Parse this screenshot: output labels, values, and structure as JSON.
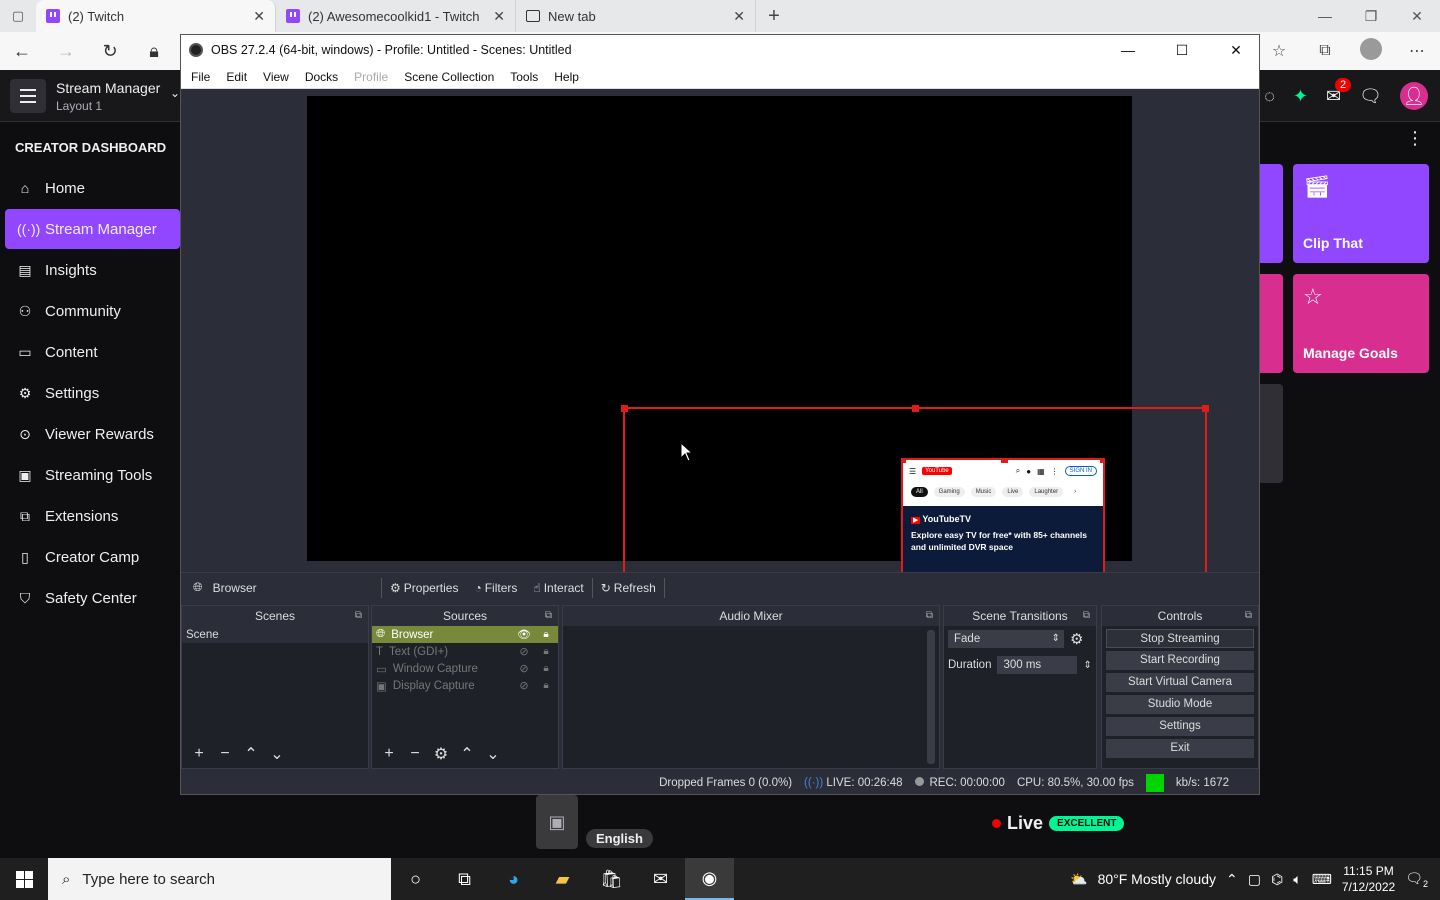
{
  "browser": {
    "tabs": [
      {
        "label": "(2) Twitch",
        "icon": "twitch-icon",
        "active": true
      },
      {
        "label": "(2) Awesomecoolkid1 - Twitch",
        "icon": "twitch-icon",
        "active": false
      },
      {
        "label": "New tab",
        "icon": "new-tab-icon",
        "active": false
      }
    ]
  },
  "twitch": {
    "stream_manager_title": "Stream Manager",
    "layout_label": "Layout 1",
    "notification_count": "2",
    "sidebar_heading": "CREATOR DASHBOARD",
    "sidebar_items": [
      {
        "label": "Home",
        "icon": "home-icon"
      },
      {
        "label": "Stream Manager",
        "icon": "broadcast-icon",
        "active": true
      },
      {
        "label": "Insights",
        "icon": "insights-icon"
      },
      {
        "label": "Community",
        "icon": "community-icon"
      },
      {
        "label": "Content",
        "icon": "content-icon"
      },
      {
        "label": "Settings",
        "icon": "settings-icon"
      },
      {
        "label": "Viewer Rewards",
        "icon": "rewards-icon"
      },
      {
        "label": "Streaming Tools",
        "icon": "camera-icon"
      },
      {
        "label": "Extensions",
        "icon": "puzzle-icon"
      },
      {
        "label": "Creator Camp",
        "icon": "book-icon"
      },
      {
        "label": "Safety Center",
        "icon": "shield-icon"
      }
    ],
    "quick_actions": [
      {
        "label": "Clip That",
        "icon": "clapper-icon",
        "color": "#9147ff"
      },
      {
        "label": "Manage Goals",
        "icon": "star-icon",
        "color": "#d72e8f"
      }
    ],
    "language": "English",
    "live_label": "Live",
    "health_label": "EXCELLENT"
  },
  "obs": {
    "title": "OBS 27.2.4 (64-bit, windows) - Profile: Untitled - Scenes: Untitled",
    "menu": [
      "File",
      "Edit",
      "View",
      "Docks",
      "Profile",
      "Scene Collection",
      "Tools",
      "Help"
    ],
    "preview_source": {
      "youtube_logo": "YouTube",
      "sign_in": "SIGN IN",
      "chips": [
        "All",
        "Gaming",
        "Music",
        "Live",
        "Laughter"
      ],
      "ad_brand": "YouTubeTV",
      "ad_text": "Explore easy TV for free* with 85+ channels and unlimited DVR space"
    },
    "source_toolbar": {
      "selected_source": "Browser",
      "properties": "Properties",
      "filters": "Filters",
      "interact": "Interact",
      "refresh": "Refresh"
    },
    "docks": {
      "scenes_title": "Scenes",
      "sources_title": "Sources",
      "audio_title": "Audio Mixer",
      "transitions_title": "Scene Transitions",
      "controls_title": "Controls"
    },
    "scenes": [
      "Scene"
    ],
    "sources": [
      {
        "name": "Browser",
        "icon": "globe-icon",
        "visible": true,
        "selected": true
      },
      {
        "name": "Text (GDI+)",
        "icon": "text-icon",
        "visible": false
      },
      {
        "name": "Window Capture",
        "icon": "window-icon",
        "visible": false
      },
      {
        "name": "Display Capture",
        "icon": "monitor-icon",
        "visible": false
      }
    ],
    "transition": {
      "type": "Fade",
      "duration_label": "Duration",
      "duration_value": "300 ms"
    },
    "controls": [
      "Stop Streaming",
      "Start Recording",
      "Start Virtual Camera",
      "Studio Mode",
      "Settings",
      "Exit"
    ],
    "status": {
      "dropped_frames": "Dropped Frames 0 (0.0%)",
      "live_time": "LIVE: 00:26:48",
      "rec_time": "REC: 00:00:00",
      "cpu": "CPU: 80.5%, 30.00 fps",
      "bitrate": "kb/s: 1672"
    }
  },
  "taskbar": {
    "search_placeholder": "Type here to search",
    "weather": "80°F  Mostly cloudy",
    "time": "11:15 PM",
    "date": "7/12/2022",
    "notification_count": "2"
  }
}
